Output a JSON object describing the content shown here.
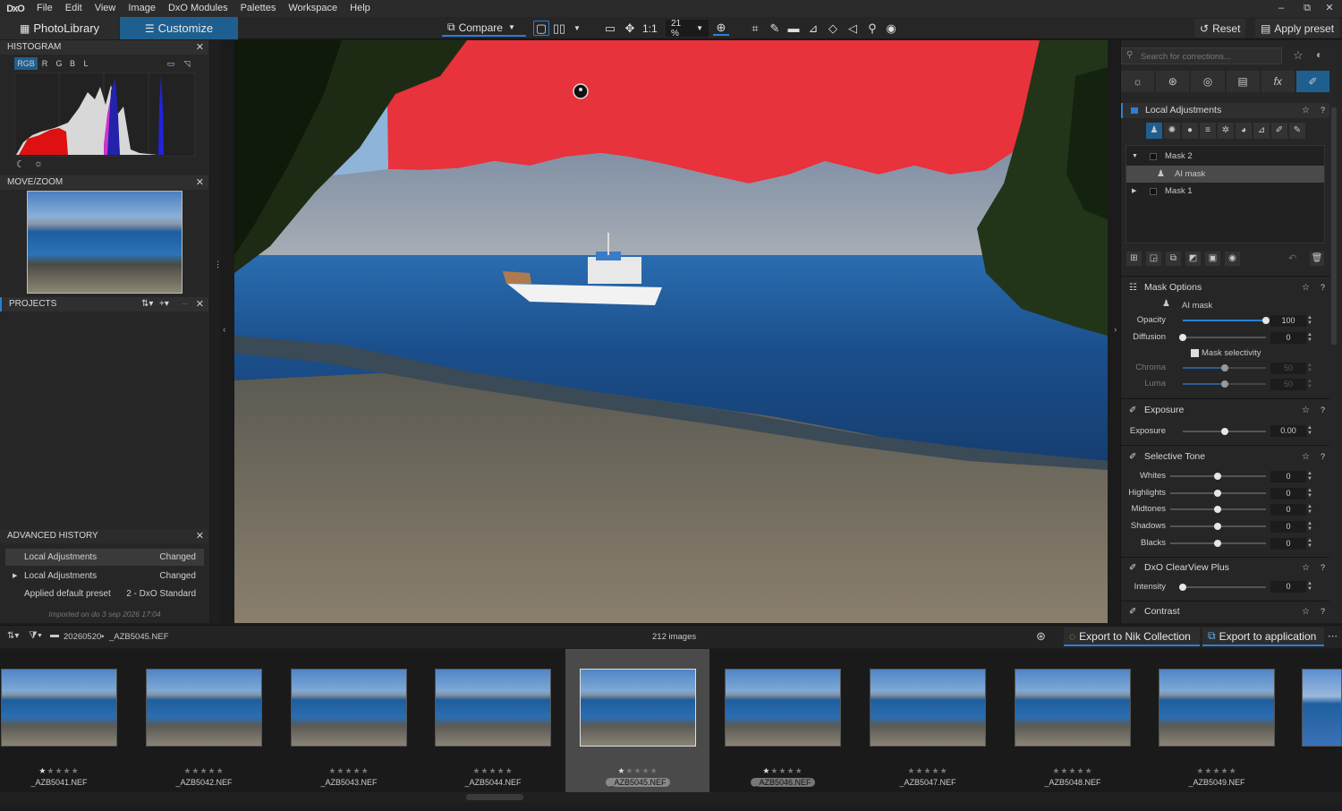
{
  "app": {
    "logo": "DxO"
  },
  "menu": [
    "File",
    "Edit",
    "View",
    "Image",
    "DxO Modules",
    "Palettes",
    "Workspace",
    "Help"
  ],
  "window_controls": [
    "–",
    "⧉",
    "✕"
  ],
  "tabs": {
    "photolibrary": "PhotoLibrary",
    "customize": "Customize"
  },
  "toolbar": {
    "compare": "Compare",
    "one_to_one": "1:1",
    "zoom": "21 %",
    "reset": "Reset",
    "apply_preset": "Apply preset"
  },
  "histogram": {
    "title": "HISTOGRAM",
    "channels": [
      "RGB",
      "R",
      "G",
      "B",
      "L"
    ],
    "active_channel": "RGB"
  },
  "movezoom": {
    "title": "MOVE/ZOOM"
  },
  "projects": {
    "title": "PROJECTS"
  },
  "history": {
    "title": "ADVANCED HISTORY",
    "rows": [
      {
        "label": "Local Adjustments",
        "value": "Changed"
      },
      {
        "label": "Local Adjustments",
        "value": "Changed"
      },
      {
        "label": "Applied default preset",
        "value": "2 - DxO Standard"
      }
    ],
    "footer": "Imported on do 3 sep 2026 17:04"
  },
  "right_panel": {
    "search_placeholder": "Search for corrections...",
    "local_adjustments": "Local Adjustments",
    "masks": [
      {
        "label": "Mask 2",
        "expanded": true
      },
      {
        "label": "AI mask",
        "child": true,
        "selected": true
      },
      {
        "label": "Mask 1",
        "expanded": false
      }
    ],
    "mask_options": {
      "title": "Mask Options",
      "mask_type": "AI mask",
      "opacity": {
        "label": "Opacity",
        "value": "100"
      },
      "diffusion": {
        "label": "Diffusion",
        "value": "0"
      },
      "mask_selectivity": "Mask selectivity",
      "chroma": {
        "label": "Chroma",
        "value": "50"
      },
      "luma": {
        "label": "Luma",
        "value": "50"
      }
    },
    "exposure": {
      "title": "Exposure",
      "label": "Exposure",
      "value": "0.00"
    },
    "selective_tone": {
      "title": "Selective Tone",
      "rows": [
        {
          "label": "Whites",
          "value": "0"
        },
        {
          "label": "Highlights",
          "value": "0"
        },
        {
          "label": "Midtones",
          "value": "0"
        },
        {
          "label": "Shadows",
          "value": "0"
        },
        {
          "label": "Blacks",
          "value": "0"
        }
      ]
    },
    "clearview": {
      "title": "DxO ClearView Plus",
      "label": "Intensity",
      "value": "0"
    },
    "contrast": {
      "title": "Contrast"
    }
  },
  "filmstrip": {
    "folder": "20260520",
    "current_file": "_AZB5045.NEF",
    "count": "212 images",
    "export_nik": "Export to Nik Collection",
    "export_app": "Export to application",
    "thumbs": [
      {
        "name": "_AZB5041.NEF",
        "stars": "★★★★★",
        "rated": 1
      },
      {
        "name": "_AZB5042.NEF",
        "stars": "★★★★★",
        "rated": 0
      },
      {
        "name": "_AZB5043.NEF",
        "stars": "★★★★★",
        "rated": 0
      },
      {
        "name": "_AZB5044.NEF",
        "stars": "★★★★★",
        "rated": 0
      },
      {
        "name": "_AZB5045.NEF",
        "stars": "★★★★★",
        "rated": 1,
        "selected": true
      },
      {
        "name": "_AZB5046.NEF",
        "stars": "★★★★★",
        "rated": 1,
        "highlight": true
      },
      {
        "name": "_AZB5047.NEF",
        "stars": "★★★★★",
        "rated": 0
      },
      {
        "name": "_AZB5048.NEF",
        "stars": "★★★★★",
        "rated": 0
      },
      {
        "name": "_AZB5049.NEF",
        "stars": "★★★★★",
        "rated": 0
      }
    ]
  },
  "colors": {
    "accent": "#2a7fd6",
    "mask_overlay": "#e8323c",
    "customize_tab": "#1f5f8f"
  }
}
